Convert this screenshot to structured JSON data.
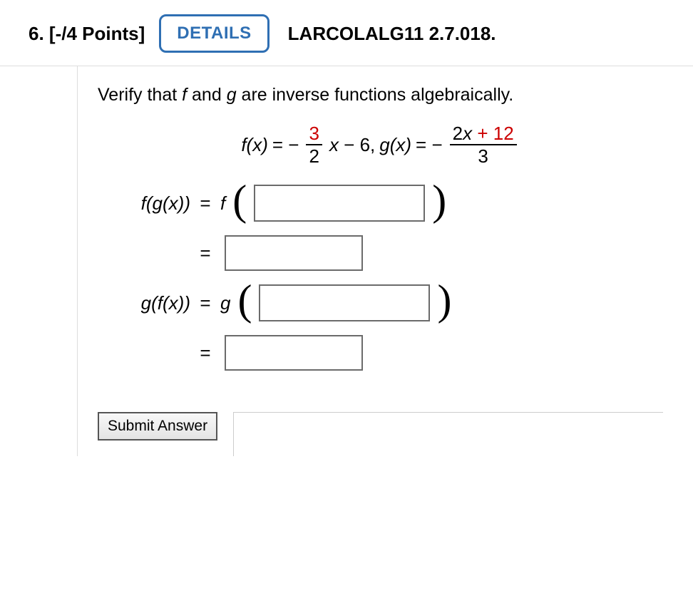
{
  "header": {
    "number": "6.",
    "points": "[-/4 Points]",
    "details_label": "DETAILS",
    "book_ref": "LARCOLALG11 2.7.018."
  },
  "prompt": {
    "pre": "Verify that ",
    "f": "f",
    "mid": " and ",
    "g": "g",
    "post": " are inverse functions algebraically."
  },
  "defs": {
    "fx_label": "f(x)",
    "eq1": " = − ",
    "frac1_num": "3",
    "frac1_den": "2",
    "after_frac1_x": "x",
    "after_frac1_rest": " − 6,  ",
    "gx_label": "g(x)",
    "eq2": " = − ",
    "frac2_num_a": "2",
    "frac2_num_x": "x",
    "frac2_num_b": " + 12",
    "frac2_den": "3"
  },
  "rows": {
    "fg_lhs": "f(g(x))",
    "f_letter": "f",
    "gf_lhs": "g(f(x))",
    "g_letter": "g",
    "eq": "="
  },
  "submit": {
    "label": "Submit Answer"
  }
}
